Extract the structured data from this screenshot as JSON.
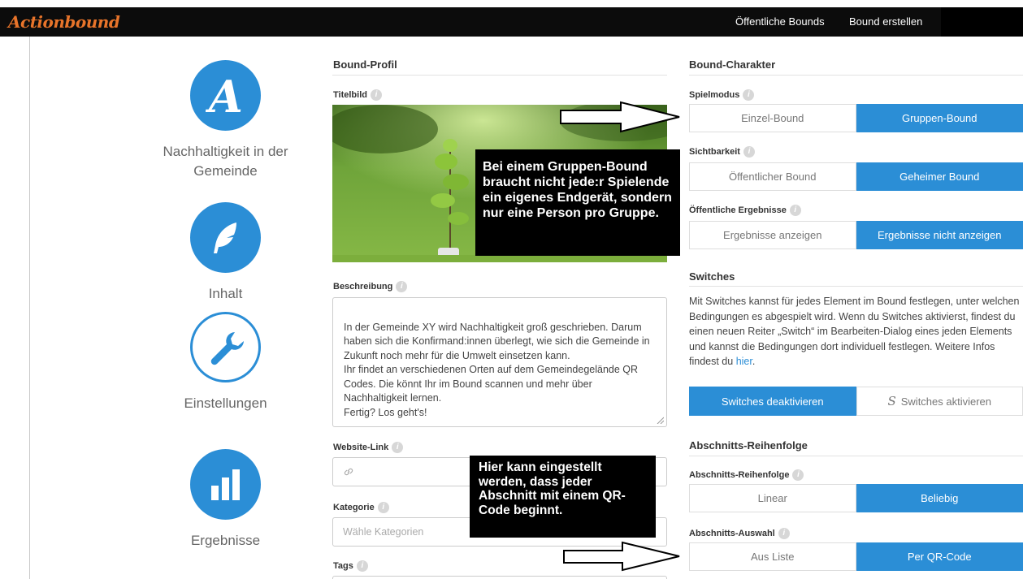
{
  "app": {
    "logo": "Actionbound"
  },
  "nav": {
    "public_bounds": "Öffentliche Bounds",
    "create_bound": "Bound erstellen"
  },
  "sidebar": {
    "items": [
      {
        "label": "Nachhaltigkeit in der Gemeinde",
        "icon": "actionbound-a-icon"
      },
      {
        "label": "Inhalt",
        "icon": "quill-feather-icon"
      },
      {
        "label": "Einstellungen",
        "icon": "wrench-icon"
      },
      {
        "label": "Ergebnisse",
        "icon": "bar-chart-icon"
      }
    ]
  },
  "profile": {
    "title": "Bound-Profil",
    "title_image_label": "Titelbild",
    "description_label": "Beschreibung",
    "description": "In der Gemeinde XY wird Nachhaltigkeit groß geschrieben. Darum haben sich die Konfirmand:innen überlegt, wie sich die Gemeinde in Zukunft noch mehr für die Umwelt einsetzen kann.\nIhr findet an verschiedenen Orten auf dem Gemeindegelände QR Codes. Die könnt Ihr im Bound scannen und mehr über Nachhaltigkeit lernen.\nFertig? Los geht's!",
    "website_label": "Website-Link",
    "category_label": "Kategorie",
    "category_placeholder": "Wähle Kategorien",
    "tags_label": "Tags"
  },
  "character": {
    "title": "Bound-Charakter",
    "game_mode": {
      "label": "Spielmodus",
      "options": [
        "Einzel-Bound",
        "Gruppen-Bound"
      ],
      "selected": 1
    },
    "visibility": {
      "label": "Sichtbarkeit",
      "options": [
        "Öffentlicher Bound",
        "Geheimer Bound"
      ],
      "selected": 1
    },
    "public_results": {
      "label": "Öffentliche Ergebnisse",
      "options": [
        "Ergebnisse anzeigen",
        "Ergebnisse nicht anzeigen"
      ],
      "selected": 1
    }
  },
  "switches": {
    "title": "Switches",
    "text_before_link": "Mit Switches kannst für jedes Element im Bound festlegen, unter welchen Bedingungen es abgespielt wird. Wenn du Switches aktivierst, findest du einen neuen Reiter „Switch“ im Bearbeiten-Dialog eines jeden Elements und kannst die Bedingungen dort individuell festlegen. Weitere Infos findest du ",
    "link": "hier",
    "text_after_link": ".",
    "options": [
      "Switches deaktivieren",
      "Switches aktivieren"
    ],
    "selected": 0
  },
  "sections": {
    "title": "Abschnitts-Reihenfolge",
    "order": {
      "label": "Abschnitts-Reihenfolge",
      "options": [
        "Linear",
        "Beliebig"
      ],
      "selected": 1
    },
    "selection": {
      "label": "Abschnitts-Auswahl",
      "options": [
        "Aus Liste",
        "Per QR-Code"
      ],
      "selected": 1
    }
  },
  "callouts": {
    "group": "Bei einem Gruppen-Bound braucht nicht jede:r Spielende ein eigenes Endgerät, sondern nur eine Person pro Gruppe.",
    "qr": "Hier kann eingestellt werden, dass jeder Abschnitt mit einem QR-Code beginnt."
  },
  "colors": {
    "accent": "#2b8ed6",
    "logo": "#e8742a",
    "topbar": "#0c0c0c"
  }
}
